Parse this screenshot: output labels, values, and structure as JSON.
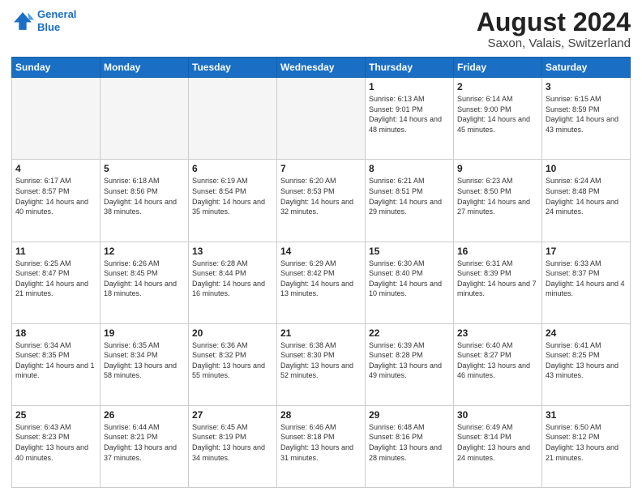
{
  "header": {
    "logo_line1": "General",
    "logo_line2": "Blue",
    "title": "August 2024",
    "subtitle": "Saxon, Valais, Switzerland"
  },
  "calendar": {
    "days_of_week": [
      "Sunday",
      "Monday",
      "Tuesday",
      "Wednesday",
      "Thursday",
      "Friday",
      "Saturday"
    ],
    "weeks": [
      [
        {
          "day": "",
          "info": ""
        },
        {
          "day": "",
          "info": ""
        },
        {
          "day": "",
          "info": ""
        },
        {
          "day": "",
          "info": ""
        },
        {
          "day": "1",
          "info": "Sunrise: 6:13 AM\nSunset: 9:01 PM\nDaylight: 14 hours and 48 minutes."
        },
        {
          "day": "2",
          "info": "Sunrise: 6:14 AM\nSunset: 9:00 PM\nDaylight: 14 hours and 45 minutes."
        },
        {
          "day": "3",
          "info": "Sunrise: 6:15 AM\nSunset: 8:59 PM\nDaylight: 14 hours and 43 minutes."
        }
      ],
      [
        {
          "day": "4",
          "info": "Sunrise: 6:17 AM\nSunset: 8:57 PM\nDaylight: 14 hours and 40 minutes."
        },
        {
          "day": "5",
          "info": "Sunrise: 6:18 AM\nSunset: 8:56 PM\nDaylight: 14 hours and 38 minutes."
        },
        {
          "day": "6",
          "info": "Sunrise: 6:19 AM\nSunset: 8:54 PM\nDaylight: 14 hours and 35 minutes."
        },
        {
          "day": "7",
          "info": "Sunrise: 6:20 AM\nSunset: 8:53 PM\nDaylight: 14 hours and 32 minutes."
        },
        {
          "day": "8",
          "info": "Sunrise: 6:21 AM\nSunset: 8:51 PM\nDaylight: 14 hours and 29 minutes."
        },
        {
          "day": "9",
          "info": "Sunrise: 6:23 AM\nSunset: 8:50 PM\nDaylight: 14 hours and 27 minutes."
        },
        {
          "day": "10",
          "info": "Sunrise: 6:24 AM\nSunset: 8:48 PM\nDaylight: 14 hours and 24 minutes."
        }
      ],
      [
        {
          "day": "11",
          "info": "Sunrise: 6:25 AM\nSunset: 8:47 PM\nDaylight: 14 hours and 21 minutes."
        },
        {
          "day": "12",
          "info": "Sunrise: 6:26 AM\nSunset: 8:45 PM\nDaylight: 14 hours and 18 minutes."
        },
        {
          "day": "13",
          "info": "Sunrise: 6:28 AM\nSunset: 8:44 PM\nDaylight: 14 hours and 16 minutes."
        },
        {
          "day": "14",
          "info": "Sunrise: 6:29 AM\nSunset: 8:42 PM\nDaylight: 14 hours and 13 minutes."
        },
        {
          "day": "15",
          "info": "Sunrise: 6:30 AM\nSunset: 8:40 PM\nDaylight: 14 hours and 10 minutes."
        },
        {
          "day": "16",
          "info": "Sunrise: 6:31 AM\nSunset: 8:39 PM\nDaylight: 14 hours and 7 minutes."
        },
        {
          "day": "17",
          "info": "Sunrise: 6:33 AM\nSunset: 8:37 PM\nDaylight: 14 hours and 4 minutes."
        }
      ],
      [
        {
          "day": "18",
          "info": "Sunrise: 6:34 AM\nSunset: 8:35 PM\nDaylight: 14 hours and 1 minute."
        },
        {
          "day": "19",
          "info": "Sunrise: 6:35 AM\nSunset: 8:34 PM\nDaylight: 13 hours and 58 minutes."
        },
        {
          "day": "20",
          "info": "Sunrise: 6:36 AM\nSunset: 8:32 PM\nDaylight: 13 hours and 55 minutes."
        },
        {
          "day": "21",
          "info": "Sunrise: 6:38 AM\nSunset: 8:30 PM\nDaylight: 13 hours and 52 minutes."
        },
        {
          "day": "22",
          "info": "Sunrise: 6:39 AM\nSunset: 8:28 PM\nDaylight: 13 hours and 49 minutes."
        },
        {
          "day": "23",
          "info": "Sunrise: 6:40 AM\nSunset: 8:27 PM\nDaylight: 13 hours and 46 minutes."
        },
        {
          "day": "24",
          "info": "Sunrise: 6:41 AM\nSunset: 8:25 PM\nDaylight: 13 hours and 43 minutes."
        }
      ],
      [
        {
          "day": "25",
          "info": "Sunrise: 6:43 AM\nSunset: 8:23 PM\nDaylight: 13 hours and 40 minutes."
        },
        {
          "day": "26",
          "info": "Sunrise: 6:44 AM\nSunset: 8:21 PM\nDaylight: 13 hours and 37 minutes."
        },
        {
          "day": "27",
          "info": "Sunrise: 6:45 AM\nSunset: 8:19 PM\nDaylight: 13 hours and 34 minutes."
        },
        {
          "day": "28",
          "info": "Sunrise: 6:46 AM\nSunset: 8:18 PM\nDaylight: 13 hours and 31 minutes."
        },
        {
          "day": "29",
          "info": "Sunrise: 6:48 AM\nSunset: 8:16 PM\nDaylight: 13 hours and 28 minutes."
        },
        {
          "day": "30",
          "info": "Sunrise: 6:49 AM\nSunset: 8:14 PM\nDaylight: 13 hours and 24 minutes."
        },
        {
          "day": "31",
          "info": "Sunrise: 6:50 AM\nSunset: 8:12 PM\nDaylight: 13 hours and 21 minutes."
        }
      ]
    ]
  }
}
